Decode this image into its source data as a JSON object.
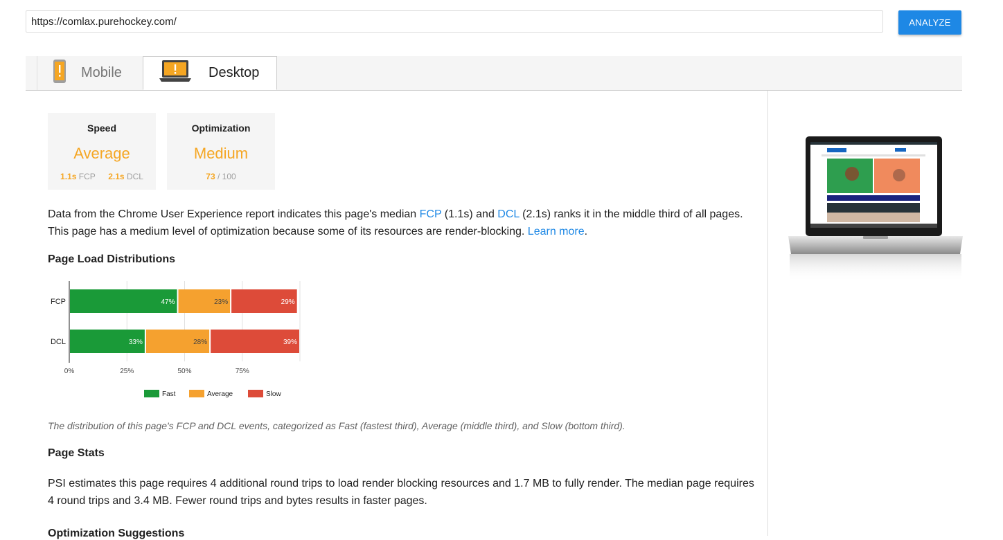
{
  "search": {
    "url": "https://comlax.purehockey.com/",
    "analyze_label": "ANALYZE"
  },
  "tabs": [
    {
      "label": "Mobile",
      "icon": "mobile-phone-warning-icon",
      "selected": false
    },
    {
      "label": "Desktop",
      "icon": "laptop-warning-icon",
      "selected": true
    }
  ],
  "speed": {
    "title": "Speed",
    "value": "Average",
    "fcp_value": "1.1s",
    "fcp_label": "FCP",
    "dcl_value": "2.1s",
    "dcl_label": "DCL"
  },
  "optimization": {
    "title": "Optimization",
    "value": "Medium",
    "score": "73",
    "score_suffix": "/ 100"
  },
  "summary": {
    "part1": "Data from the Chrome User Experience report indicates this page's median ",
    "fcp_link": "FCP",
    "part2": " (1.1s) and ",
    "dcl_link": "DCL",
    "part3": " (2.1s) ranks it in the middle third of all pages. This page has a medium level of optimization because some of its resources are render-blocking. ",
    "learn_more": "Learn more",
    "part4": "."
  },
  "page_load_heading": "Page Load Distributions",
  "chart_data": {
    "type": "bar",
    "orientation": "horizontal-stacked",
    "categories": [
      "FCP",
      "DCL"
    ],
    "series": [
      {
        "name": "Fast",
        "values": [
          47,
          33
        ],
        "color": "#1a9a38"
      },
      {
        "name": "Average",
        "values": [
          23,
          28
        ],
        "color": "#f5a12f"
      },
      {
        "name": "Slow",
        "values": [
          29,
          39
        ],
        "color": "#dd4b39"
      }
    ],
    "value_labels": [
      [
        "47%",
        "23%",
        "29%"
      ],
      [
        "33%",
        "28%",
        "39%"
      ]
    ],
    "xticks": [
      "0%",
      "25%",
      "50%",
      "75%"
    ],
    "xlim": [
      0,
      100
    ],
    "grid": true,
    "legend": "bottom"
  },
  "chart_caption": "The distribution of this page's FCP and DCL events, categorized as Fast (fastest third), Average (middle third), and Slow (bottom third).",
  "page_stats": {
    "heading": "Page Stats",
    "text": "PSI estimates this page requires 4 additional round trips to load render blocking resources and 1.7 MB to fully render. The median page requires 4 round trips and 3.4 MB. Fewer round trips and bytes results in faster pages."
  },
  "optimization_suggestions_heading": "Optimization Suggestions"
}
